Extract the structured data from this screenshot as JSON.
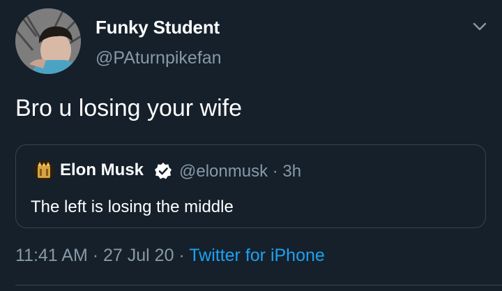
{
  "tweet": {
    "display_name": "Funky Student",
    "handle": "@PAturnpikefan",
    "text": "Bro u losing your wife",
    "time": "11:41 AM",
    "separator": "·",
    "date": "27 Jul 20",
    "source": "Twitter for iPhone",
    "avatar_icon": "user-photo",
    "menu_icon": "chevron-down-icon"
  },
  "quoted_tweet": {
    "display_name": "Elon Musk",
    "verified_icon": "verified-badge-icon",
    "handle": "@elonmusk",
    "separator": "·",
    "age": "3h",
    "text": "The left is losing the middle",
    "avatar_icon": "user-photo"
  },
  "colors": {
    "background": "#15202b",
    "primary_text": "#ffffff",
    "secondary_text": "#8899a6",
    "link": "#1da1f2",
    "border": "#38444d"
  }
}
